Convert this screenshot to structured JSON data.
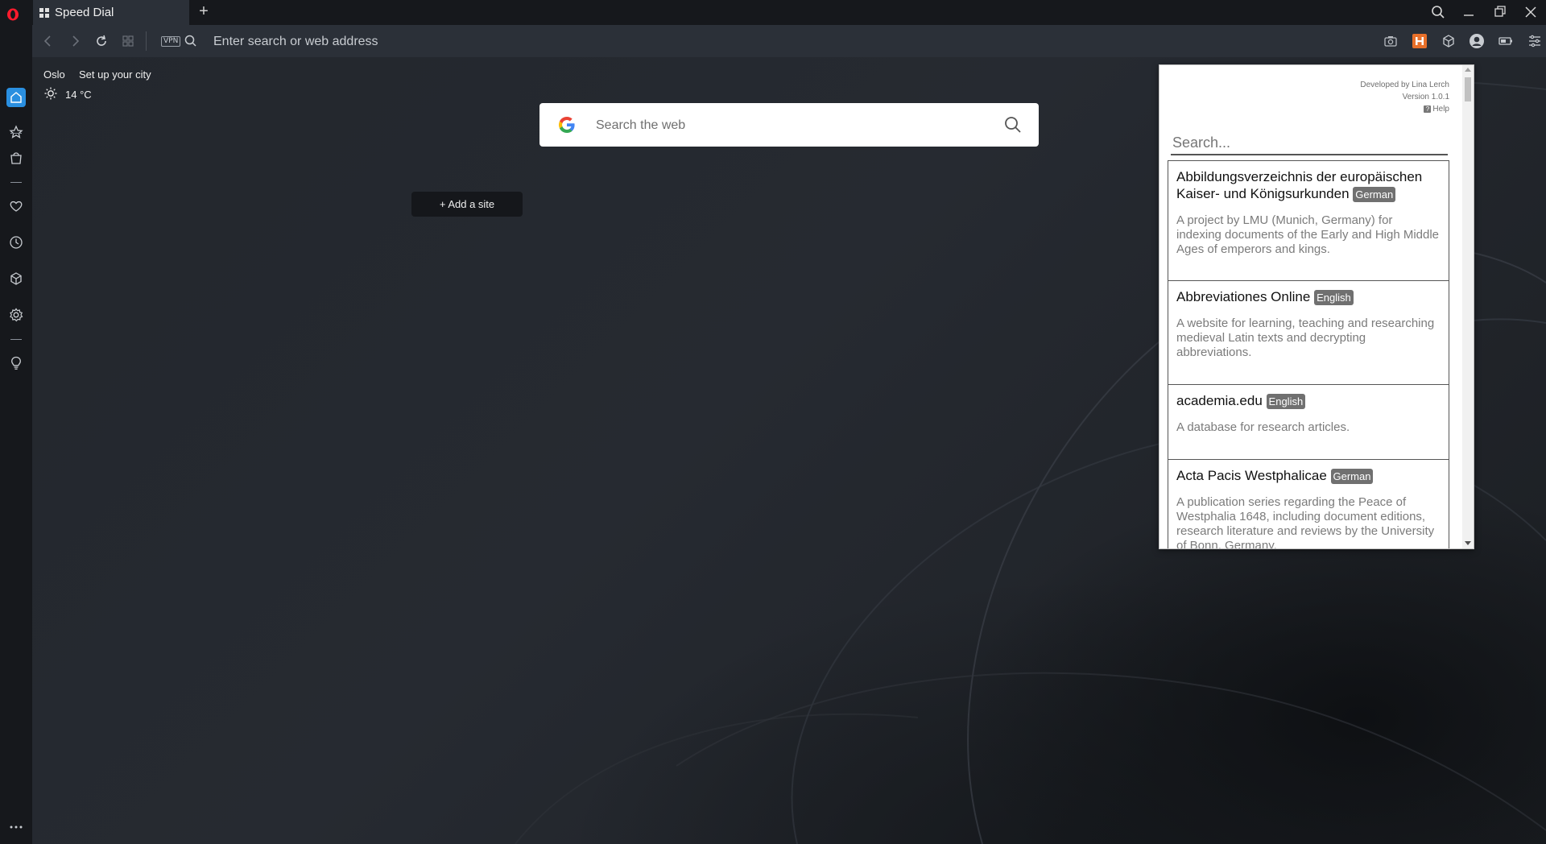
{
  "browser": {
    "tab_title": "Speed Dial",
    "address_placeholder": "Enter search or web address",
    "vpn_label": "VPN"
  },
  "weather": {
    "city": "Oslo",
    "setup_link": "Set up your city",
    "temperature": "14 °C"
  },
  "speed_dial": {
    "search_placeholder": "Search the web",
    "add_site_label": "+ Add a site"
  },
  "sidebar": {
    "items": [
      "home-icon",
      "star-icon",
      "shopping-bag-icon",
      "heart-icon",
      "history-icon",
      "extensions-icon",
      "settings-icon",
      "lightbulb-icon"
    ]
  },
  "popup": {
    "developer": "Developed by Lina Lerch",
    "version": "Version 1.0.1",
    "help": "Help",
    "search_placeholder": "Search...",
    "results": [
      {
        "title": "Abbildungsverzeichnis der europäischen Kaiser- und Königsurkunden",
        "language": "German",
        "description": "A project by LMU (Munich, Germany) for indexing documents of the Early and High Middle Ages of emperors and kings."
      },
      {
        "title": "Abbreviationes Online",
        "language": "English",
        "description": "A website for learning, teaching and researching medieval Latin texts and decrypting abbreviations."
      },
      {
        "title": "academia.edu",
        "language": "English",
        "description": "A database for research articles."
      },
      {
        "title": "Acta Pacis Westphalicae",
        "language": "German",
        "description": "A publication series regarding the Peace of Westphalia 1648, including document editions, research literature and reviews by the University of Bonn, Germany."
      }
    ]
  },
  "colors": {
    "accent": "#2a8fe0",
    "opera_red": "#ff1b2d",
    "extension_orange": "#e8702a"
  }
}
